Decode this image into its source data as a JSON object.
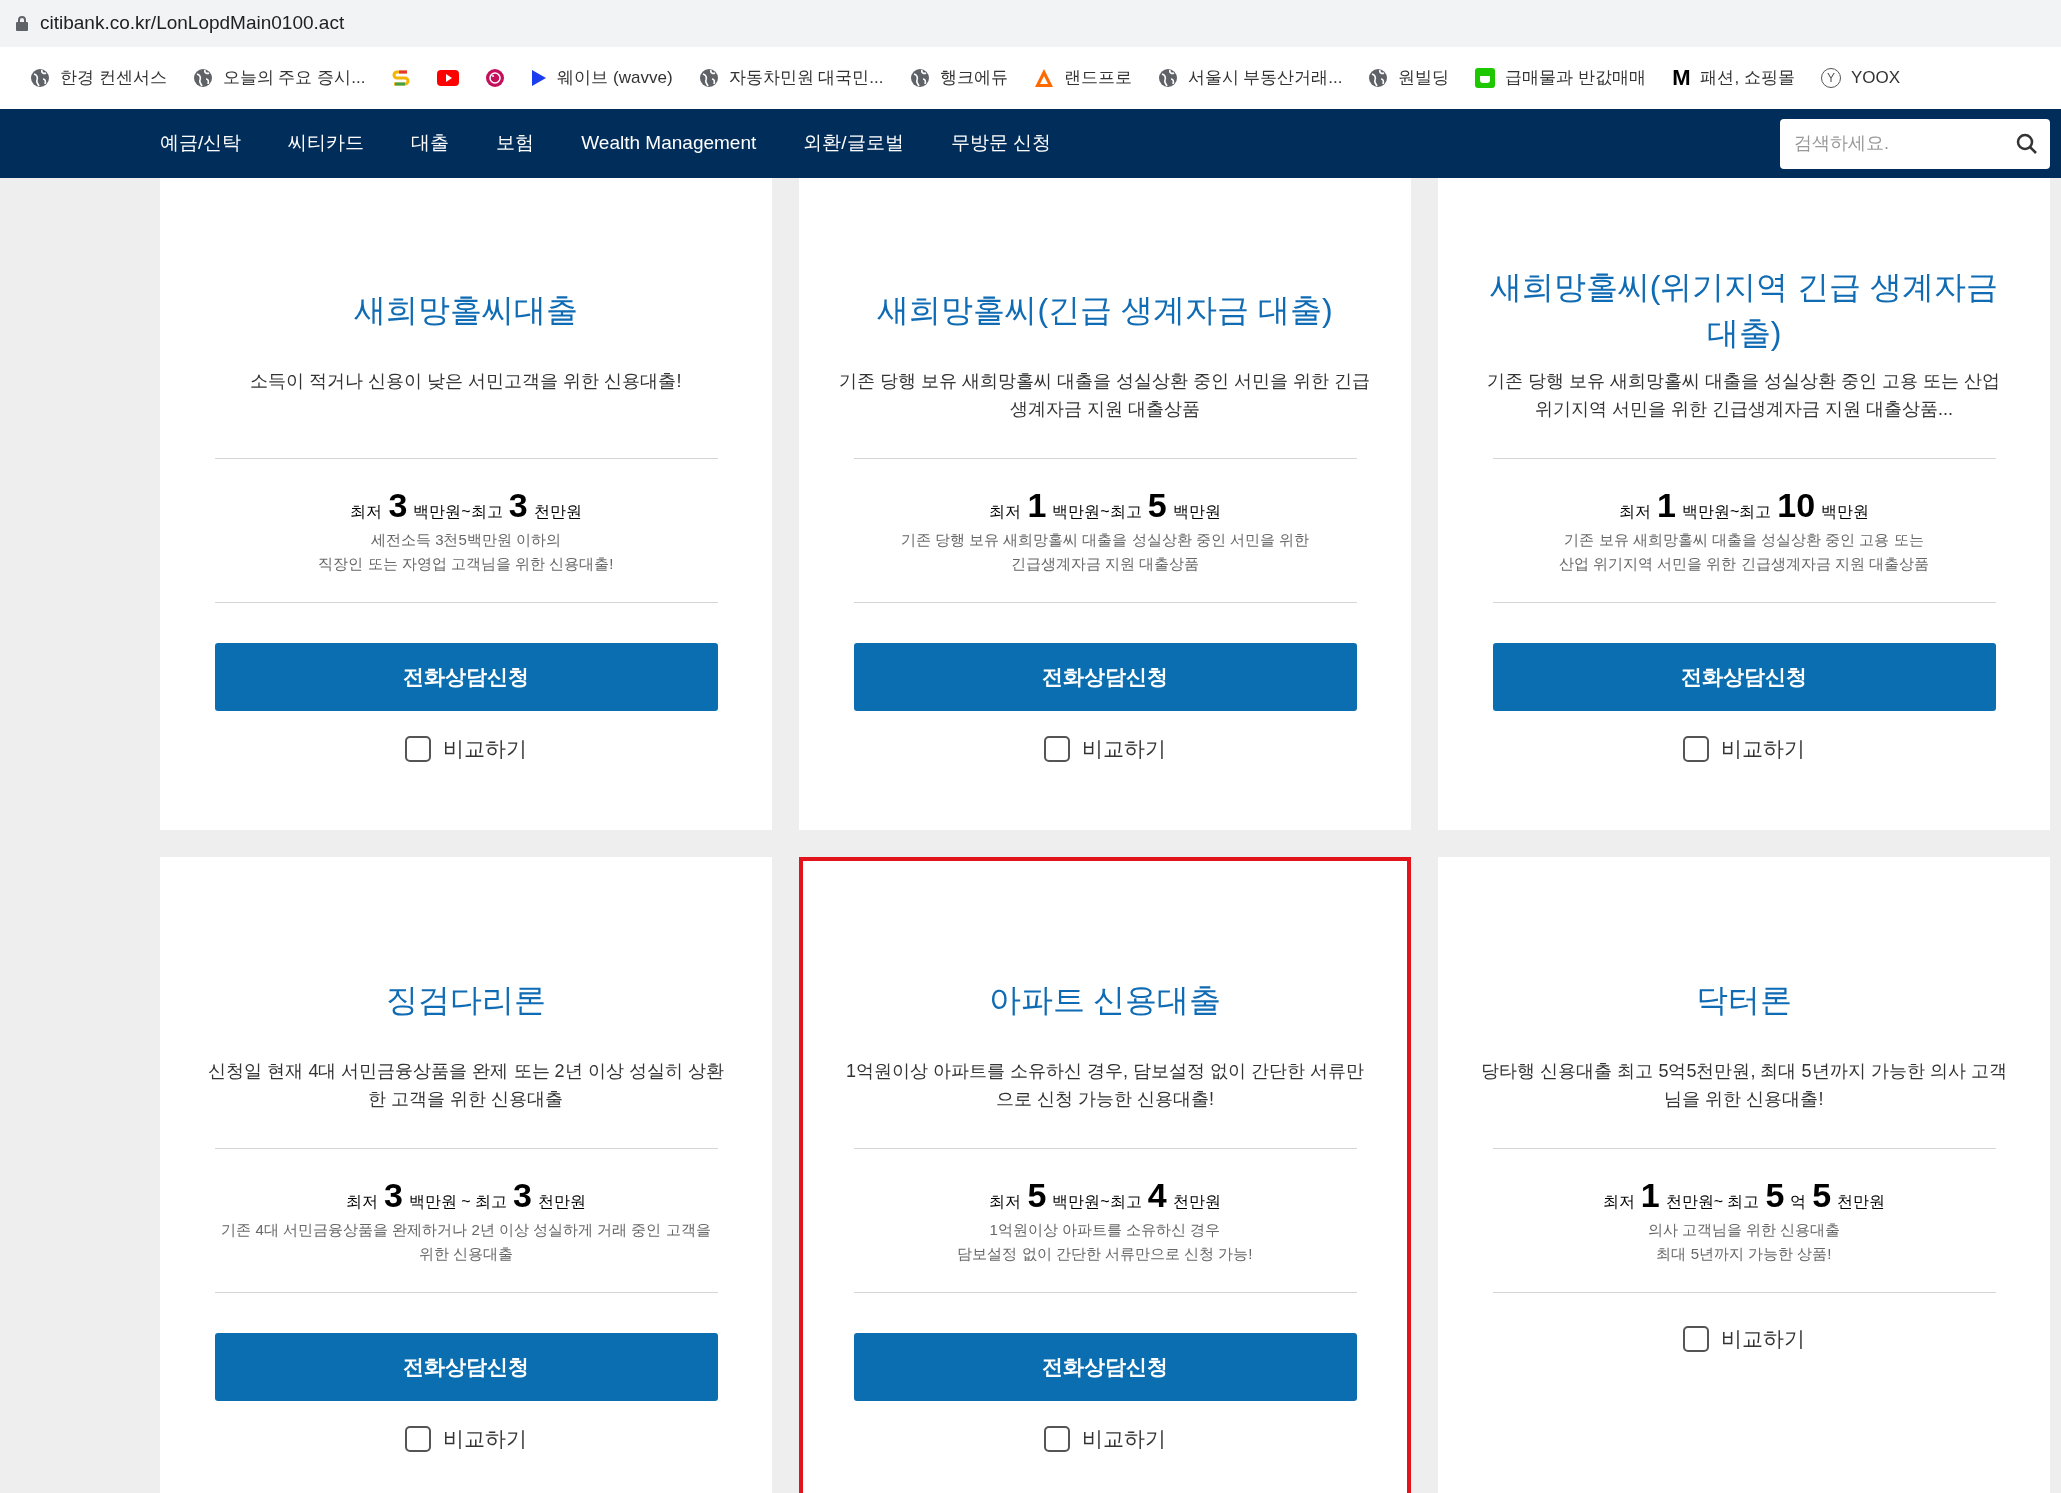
{
  "address_bar": {
    "url": "citibank.co.kr/LonLopdMain0100.act"
  },
  "bookmarks": [
    {
      "kind": "globe",
      "label": "한경 컨센서스"
    },
    {
      "kind": "globe",
      "label": "오늘의 주요 증시..."
    },
    {
      "kind": "slogo"
    },
    {
      "kind": "video"
    },
    {
      "kind": "lg"
    },
    {
      "kind": "play",
      "label": "웨이브 (wavve)"
    },
    {
      "kind": "globe",
      "label": "자동차민원 대국민..."
    },
    {
      "kind": "globe",
      "label": "행크에듀"
    },
    {
      "kind": "triangle",
      "label": "랜드프로"
    },
    {
      "kind": "globe",
      "label": "서울시 부동산거래..."
    },
    {
      "kind": "globe",
      "label": "원빌딩"
    },
    {
      "kind": "chat",
      "label": "급매물과 반값매매"
    },
    {
      "kind": "letter",
      "glyph": "M",
      "label": "패션, 쇼핑몰"
    },
    {
      "kind": "circled",
      "glyph": "Y",
      "label": "YOOX"
    }
  ],
  "nav": {
    "items": [
      "예금/신탁",
      "씨티카드",
      "대출",
      "보험",
      "Wealth Management",
      "외환/글로벌",
      "무방문 신청"
    ],
    "search": {
      "placeholder": "검색하세요."
    }
  },
  "cards": [
    {
      "title": "새희망홀씨대출",
      "description": "소득이 적거나 신용이 낮은 서민고객을 위한 신용대출!",
      "amount": [
        {
          "kind": "label",
          "text": "최저"
        },
        {
          "kind": "number",
          "text": "3"
        },
        {
          "kind": "label",
          "text": "백만원~최고"
        },
        {
          "kind": "number",
          "text": "3"
        },
        {
          "kind": "label",
          "text": "천만원"
        }
      ],
      "note": [
        "세전소득 3천5백만원 이하의",
        "직장인 또는 자영업 고객님을 위한 신용대출!"
      ],
      "button": "전화상담신청",
      "compare": {
        "label": "비교하기",
        "checked": false
      },
      "highlighted": false
    },
    {
      "title": "새희망홀씨(긴급 생계자금 대출)",
      "description": "기존 당행 보유 새희망홀씨 대출을 성실상환 중인 서민을 위한 긴급생계자금 지원 대출상품",
      "amount": [
        {
          "kind": "label",
          "text": "최저"
        },
        {
          "kind": "number",
          "text": "1"
        },
        {
          "kind": "label",
          "text": "백만원~최고"
        },
        {
          "kind": "number",
          "text": "5"
        },
        {
          "kind": "label",
          "text": "백만원"
        }
      ],
      "note": [
        "기존 당행 보유 새희망홀씨 대출을 성실상환 중인 서민을 위한",
        "긴급생계자금 지원 대출상품"
      ],
      "button": "전화상담신청",
      "compare": {
        "label": "비교하기",
        "checked": false
      },
      "highlighted": false
    },
    {
      "title": "새희망홀씨(위기지역 긴급 생계자금 대출)",
      "description": "기존 당행 보유 새희망홀씨 대출을 성실상환 중인 고용 또는 산업 위기지역 서민을 위한 긴급생계자금 지원 대출상품...",
      "amount": [
        {
          "kind": "label",
          "text": "최저"
        },
        {
          "kind": "number",
          "text": "1"
        },
        {
          "kind": "label",
          "text": "백만원~최고"
        },
        {
          "kind": "number",
          "text": "10"
        },
        {
          "kind": "label",
          "text": "백만원"
        }
      ],
      "note": [
        "기존 보유 새희망홀씨 대출을 성실상환 중인 고용 또는",
        "산업 위기지역 서민을 위한 긴급생계자금 지원 대출상품"
      ],
      "button": "전화상담신청",
      "compare": {
        "label": "비교하기",
        "checked": false
      },
      "highlighted": false
    },
    {
      "title": "징검다리론",
      "description": "신청일 현재 4대 서민금융상품을 완제 또는 2년 이상 성실히 상환한 고객을 위한 신용대출",
      "amount": [
        {
          "kind": "label",
          "text": "최저"
        },
        {
          "kind": "number",
          "text": "3"
        },
        {
          "kind": "label",
          "text": "백만원 ~ 최고"
        },
        {
          "kind": "number",
          "text": "3"
        },
        {
          "kind": "label",
          "text": "천만원"
        }
      ],
      "note": [
        "기존 4대 서민금융상품을 완제하거나 2년 이상 성실하게 거래 중인 고객을",
        "위한 신용대출"
      ],
      "button": "전화상담신청",
      "compare": {
        "label": "비교하기",
        "checked": false
      },
      "highlighted": false
    },
    {
      "title": "아파트 신용대출",
      "description": "1억원이상 아파트를 소유하신 경우, 담보설정 없이 간단한 서류만으로 신청 가능한 신용대출!",
      "amount": [
        {
          "kind": "label",
          "text": "최저"
        },
        {
          "kind": "number",
          "text": "5"
        },
        {
          "kind": "label",
          "text": "백만원~최고"
        },
        {
          "kind": "number",
          "text": "4"
        },
        {
          "kind": "label",
          "text": "천만원"
        }
      ],
      "note": [
        "1억원이상 아파트를 소유하신 경우",
        "담보설정 없이 간단한 서류만으로 신청 가능!"
      ],
      "button": "전화상담신청",
      "compare": {
        "label": "비교하기",
        "checked": false
      },
      "highlighted": true
    },
    {
      "title": "닥터론",
      "description": "당타행 신용대출 최고 5억5천만원, 최대 5년까지 가능한 의사 고객님을 위한 신용대출!",
      "amount": [
        {
          "kind": "label",
          "text": "최저"
        },
        {
          "kind": "number",
          "text": "1"
        },
        {
          "kind": "label",
          "text": "천만원~ 최고"
        },
        {
          "kind": "number",
          "text": "5"
        },
        {
          "kind": "label",
          "text": "억"
        },
        {
          "kind": "number",
          "text": "5"
        },
        {
          "kind": "label",
          "text": "천만원"
        }
      ],
      "note": [
        "의사 고객님을 위한 신용대출",
        "최대 5년까지 가능한 상품!"
      ],
      "compare": {
        "label": "비교하기",
        "checked": false
      },
      "highlighted": false
    }
  ]
}
